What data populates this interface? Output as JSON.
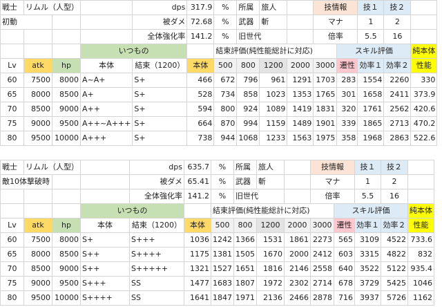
{
  "sections": [
    {
      "info": {
        "class_label": "戦士",
        "name": "リムル（人型）",
        "dps_label": "dps",
        "dps": "317.9",
        "pct1": "%",
        "affil_label": "所属",
        "affil": "旅人",
        "skill_info": "技情報",
        "skill1": "技１",
        "skill2": "技２",
        "trigger": "初動",
        "dmg_label": "被ダメ",
        "dmg": "72.68",
        "pct2": "%",
        "weapon_label": "武器",
        "weapon": "斬",
        "mana_label": "マナ",
        "mana1": "1",
        "mana2": "2",
        "boost_label": "全体強化率",
        "boost": "141.2",
        "pct3": "%",
        "gen": "旧世代",
        "mult_label": "倍率",
        "mult1": "5.5",
        "mult2": "16"
      },
      "groups": {
        "itsumono": "いつもの",
        "kessoku_eval": "結束評価(純性能総計に対応)",
        "skill_eval": "スキル評価",
        "pure_label": "純本体"
      },
      "headers": [
        "Lv",
        "atk",
        "hp",
        "本体",
        "結束（1200）",
        "本体",
        "500",
        "800",
        "1200",
        "2000",
        "3000",
        "遷性",
        "効率１",
        "効率２",
        "性能"
      ],
      "rows": [
        [
          "60",
          "7500",
          "8000",
          "A~A+",
          "S+",
          "466",
          "672",
          "796",
          "961",
          "1291",
          "1703",
          "283",
          "1554",
          "2260",
          "330"
        ],
        [
          "65",
          "8000",
          "8500",
          "A+",
          "S+",
          "528",
          "734",
          "858",
          "1023",
          "1353",
          "1765",
          "301",
          "1658",
          "2411",
          "373.9"
        ],
        [
          "70",
          "8500",
          "9000",
          "A++",
          "S+",
          "594",
          "800",
          "924",
          "1089",
          "1419",
          "1831",
          "320",
          "1761",
          "2562",
          "420.6"
        ],
        [
          "75",
          "9000",
          "9500",
          "A++~A+++",
          "S+",
          "664",
          "870",
          "994",
          "1159",
          "1489",
          "1901",
          "339",
          "1865",
          "2713",
          "470.2"
        ],
        [
          "80",
          "9500",
          "10000",
          "A+++",
          "S+",
          "738",
          "944",
          "1068",
          "1233",
          "1563",
          "1975",
          "358",
          "1968",
          "2863",
          "522.6"
        ]
      ]
    },
    {
      "info": {
        "class_label": "戦士",
        "name": "リムル（人型）",
        "dps_label": "dps",
        "dps": "635.7",
        "pct1": "%",
        "affil_label": "所属",
        "affil": "旅人",
        "skill_info": "技情報",
        "skill1": "技１",
        "skill2": "技２",
        "trigger": "敵10体撃破時",
        "dmg_label": "被ダメ",
        "dmg": "65.41",
        "pct2": "%",
        "weapon_label": "武器",
        "weapon": "斬",
        "mana_label": "マナ",
        "mana1": "1",
        "mana2": "2",
        "boost_label": "全体強化率",
        "boost": "141.2",
        "pct3": "%",
        "gen": "旧世代",
        "mult_label": "倍率",
        "mult1": "5.5",
        "mult2": "16"
      },
      "groups": {
        "itsumono": "いつもの",
        "kessoku_eval": "結束評価(純性能総計に対応)",
        "skill_eval": "スキル評価",
        "pure_label": "純本体"
      },
      "headers": [
        "Lv",
        "atk",
        "hp",
        "本体",
        "結束（1200）",
        "本体",
        "500",
        "800",
        "1200",
        "2000",
        "3000",
        "遷性",
        "効率１",
        "効率２",
        "性能"
      ],
      "rows": [
        [
          "60",
          "7500",
          "8000",
          "S+",
          "S+++",
          "1036",
          "1242",
          "1366",
          "1531",
          "1861",
          "2273",
          "565",
          "3109",
          "4522",
          "733.6"
        ],
        [
          "65",
          "8000",
          "8500",
          "S++",
          "S++++",
          "1175",
          "1381",
          "1505",
          "1670",
          "2000",
          "2412",
          "603",
          "3315",
          "4822",
          "832"
        ],
        [
          "70",
          "8500",
          "9000",
          "S++",
          "S+++++",
          "1321",
          "1527",
          "1651",
          "1816",
          "2146",
          "2558",
          "640",
          "3522",
          "5122",
          "935.4"
        ],
        [
          "75",
          "9000",
          "9500",
          "S+++",
          "SS",
          "1477",
          "1683",
          "1807",
          "1972",
          "2302",
          "2714",
          "678",
          "3729",
          "5425",
          "1046"
        ],
        [
          "80",
          "9500",
          "10000",
          "S++++",
          "SS",
          "1641",
          "1847",
          "1971",
          "2136",
          "2466",
          "2878",
          "716",
          "3937",
          "5726",
          "1162"
        ]
      ]
    }
  ]
}
